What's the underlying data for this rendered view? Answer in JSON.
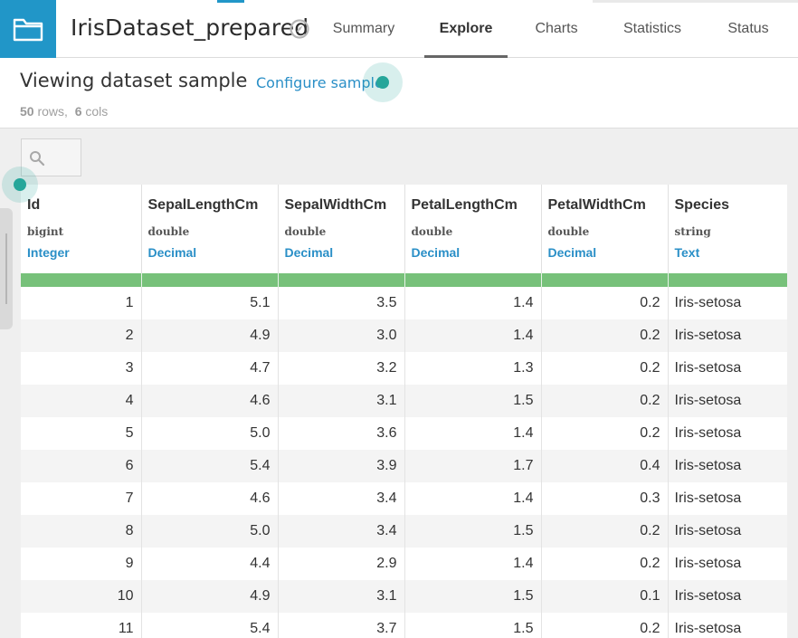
{
  "app": {
    "dataset_title": "IrisDataset_prepared",
    "icons": {
      "app_icon": "folder-icon",
      "flow_icon": "compass-icon"
    }
  },
  "nav": {
    "tabs": [
      {
        "label": "Summary",
        "active": false
      },
      {
        "label": "Explore",
        "active": true
      },
      {
        "label": "Charts",
        "active": false
      },
      {
        "label": "Statistics",
        "active": false
      },
      {
        "label": "Status",
        "active": false
      }
    ]
  },
  "sample": {
    "title": "Viewing dataset sample",
    "configure_label": "Configure sample",
    "rows_count": "50",
    "rows_word": "rows,",
    "cols_count": "6",
    "cols_word": "cols"
  },
  "search": {
    "icon": "search-icon"
  },
  "table": {
    "columns": [
      {
        "name": "Id",
        "type": "bigint",
        "meaning": "Integer"
      },
      {
        "name": "SepalLengthCm",
        "type": "double",
        "meaning": "Decimal"
      },
      {
        "name": "SepalWidthCm",
        "type": "double",
        "meaning": "Decimal"
      },
      {
        "name": "PetalLengthCm",
        "type": "double",
        "meaning": "Decimal"
      },
      {
        "name": "PetalWidthCm",
        "type": "double",
        "meaning": "Decimal"
      },
      {
        "name": "Species",
        "type": "string",
        "meaning": "Text"
      }
    ],
    "rows": [
      [
        "1",
        "5.1",
        "3.5",
        "1.4",
        "0.2",
        "Iris-setosa"
      ],
      [
        "2",
        "4.9",
        "3.0",
        "1.4",
        "0.2",
        "Iris-setosa"
      ],
      [
        "3",
        "4.7",
        "3.2",
        "1.3",
        "0.2",
        "Iris-setosa"
      ],
      [
        "4",
        "4.6",
        "3.1",
        "1.5",
        "0.2",
        "Iris-setosa"
      ],
      [
        "5",
        "5.0",
        "3.6",
        "1.4",
        "0.2",
        "Iris-setosa"
      ],
      [
        "6",
        "5.4",
        "3.9",
        "1.7",
        "0.4",
        "Iris-setosa"
      ],
      [
        "7",
        "4.6",
        "3.4",
        "1.4",
        "0.3",
        "Iris-setosa"
      ],
      [
        "8",
        "5.0",
        "3.4",
        "1.5",
        "0.2",
        "Iris-setosa"
      ],
      [
        "9",
        "4.4",
        "2.9",
        "1.4",
        "0.2",
        "Iris-setosa"
      ],
      [
        "10",
        "4.9",
        "3.1",
        "1.5",
        "0.1",
        "Iris-setosa"
      ],
      [
        "11",
        "5.4",
        "3.7",
        "1.5",
        "0.2",
        "Iris-setosa"
      ]
    ]
  },
  "colors": {
    "brand": "#2196c8",
    "link": "#2a8fc7",
    "quality_bar": "#77c17a",
    "cursor": "#26a69a"
  }
}
